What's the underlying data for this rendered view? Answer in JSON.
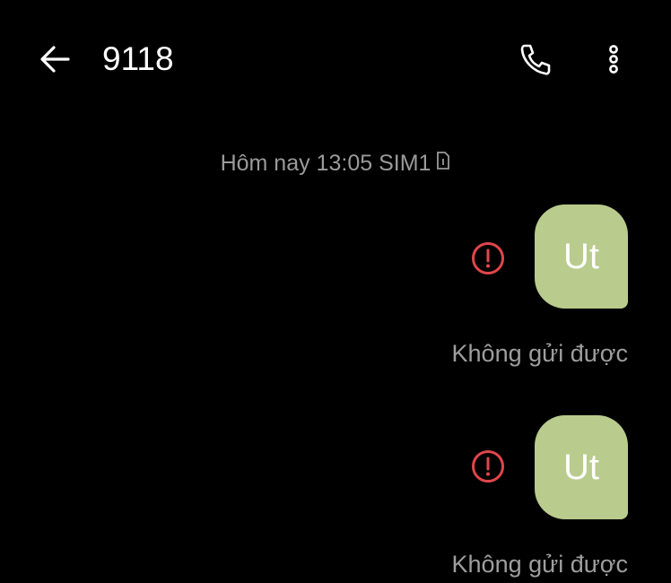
{
  "header": {
    "back_icon": "arrow-left-icon",
    "title": "9118",
    "call_icon": "phone-icon",
    "more_icon": "more-vertical-icon"
  },
  "conversation": {
    "timestamp": "Hôm nay 13:05 SIM1",
    "sim_icon": "sim-card-icon",
    "messages": [
      {
        "text": "Ut",
        "status": "Không gửi được",
        "error_icon": "error-alert-icon"
      },
      {
        "text": "Ut",
        "status": "Không gửi được",
        "error_icon": "error-alert-icon"
      }
    ]
  },
  "colors": {
    "background": "#000000",
    "bubble": "#b9cc8d",
    "error": "#e0464c",
    "muted_text": "#9e9e9e"
  }
}
